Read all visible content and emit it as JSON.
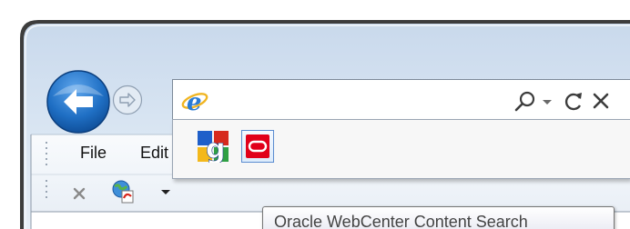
{
  "browser": {
    "menu": {
      "file_label": "File",
      "edit_label": "Edit"
    },
    "address_bar": {
      "value": "",
      "placeholder": ""
    },
    "search_providers": [
      {
        "name": "google-icon"
      },
      {
        "name": "oracle-webcenter-icon"
      }
    ],
    "tooltip": "Oracle WebCenter Content Search",
    "icons": {
      "back": "back-arrow-icon",
      "forward": "forward-arrow-icon",
      "search": "search-icon",
      "dropdown": "chevron-down-icon",
      "refresh": "refresh-icon",
      "stop": "close-icon",
      "ie": "internet-explorer-icon",
      "cmd_close": "close-icon",
      "web_slice": "web-slice-icon"
    },
    "colors": {
      "frame_border": "#3b3b3b",
      "glass": "#d5e3f2",
      "back_button": "#1f6fc4",
      "oracle_red": "#e1001a",
      "provider_highlight": "#5b8cd0"
    }
  }
}
